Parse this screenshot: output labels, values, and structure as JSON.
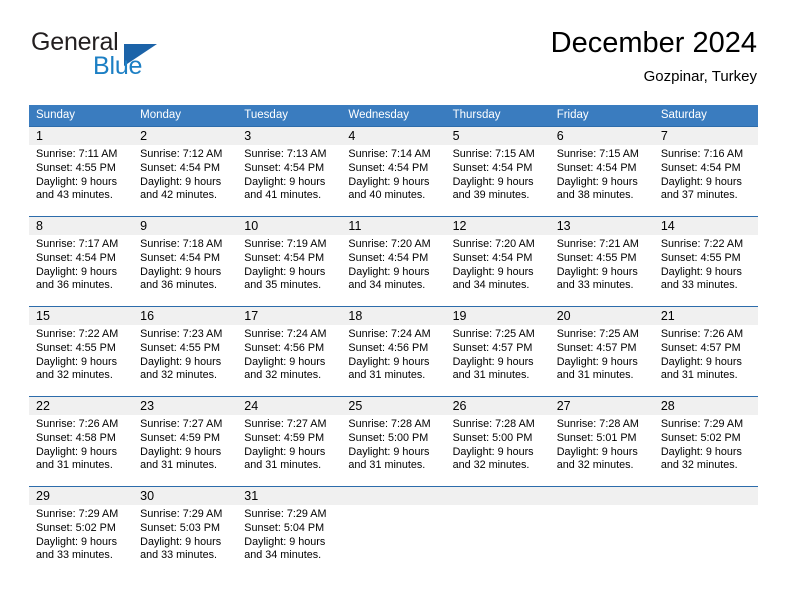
{
  "brand": {
    "name_top": "General",
    "name_bottom": "Blue",
    "colors": {
      "general": "#231f20",
      "blue": "#1c7fc4",
      "triangle": "#1c63a8"
    }
  },
  "header": {
    "title": "December 2024",
    "subtitle": "Gozpinar, Turkey"
  },
  "theme": {
    "header_bg": "#3a7cbf",
    "row_divider": "#2d6cab",
    "daynum_bg": "#f0f0f0"
  },
  "weekdays": [
    "Sunday",
    "Monday",
    "Tuesday",
    "Wednesday",
    "Thursday",
    "Friday",
    "Saturday"
  ],
  "weeks": [
    [
      {
        "day": "1",
        "sunrise": "Sunrise: 7:11 AM",
        "sunset": "Sunset: 4:55 PM",
        "daylight1": "Daylight: 9 hours",
        "daylight2": "and 43 minutes."
      },
      {
        "day": "2",
        "sunrise": "Sunrise: 7:12 AM",
        "sunset": "Sunset: 4:54 PM",
        "daylight1": "Daylight: 9 hours",
        "daylight2": "and 42 minutes."
      },
      {
        "day": "3",
        "sunrise": "Sunrise: 7:13 AM",
        "sunset": "Sunset: 4:54 PM",
        "daylight1": "Daylight: 9 hours",
        "daylight2": "and 41 minutes."
      },
      {
        "day": "4",
        "sunrise": "Sunrise: 7:14 AM",
        "sunset": "Sunset: 4:54 PM",
        "daylight1": "Daylight: 9 hours",
        "daylight2": "and 40 minutes."
      },
      {
        "day": "5",
        "sunrise": "Sunrise: 7:15 AM",
        "sunset": "Sunset: 4:54 PM",
        "daylight1": "Daylight: 9 hours",
        "daylight2": "and 39 minutes."
      },
      {
        "day": "6",
        "sunrise": "Sunrise: 7:15 AM",
        "sunset": "Sunset: 4:54 PM",
        "daylight1": "Daylight: 9 hours",
        "daylight2": "and 38 minutes."
      },
      {
        "day": "7",
        "sunrise": "Sunrise: 7:16 AM",
        "sunset": "Sunset: 4:54 PM",
        "daylight1": "Daylight: 9 hours",
        "daylight2": "and 37 minutes."
      }
    ],
    [
      {
        "day": "8",
        "sunrise": "Sunrise: 7:17 AM",
        "sunset": "Sunset: 4:54 PM",
        "daylight1": "Daylight: 9 hours",
        "daylight2": "and 36 minutes."
      },
      {
        "day": "9",
        "sunrise": "Sunrise: 7:18 AM",
        "sunset": "Sunset: 4:54 PM",
        "daylight1": "Daylight: 9 hours",
        "daylight2": "and 36 minutes."
      },
      {
        "day": "10",
        "sunrise": "Sunrise: 7:19 AM",
        "sunset": "Sunset: 4:54 PM",
        "daylight1": "Daylight: 9 hours",
        "daylight2": "and 35 minutes."
      },
      {
        "day": "11",
        "sunrise": "Sunrise: 7:20 AM",
        "sunset": "Sunset: 4:54 PM",
        "daylight1": "Daylight: 9 hours",
        "daylight2": "and 34 minutes."
      },
      {
        "day": "12",
        "sunrise": "Sunrise: 7:20 AM",
        "sunset": "Sunset: 4:54 PM",
        "daylight1": "Daylight: 9 hours",
        "daylight2": "and 34 minutes."
      },
      {
        "day": "13",
        "sunrise": "Sunrise: 7:21 AM",
        "sunset": "Sunset: 4:55 PM",
        "daylight1": "Daylight: 9 hours",
        "daylight2": "and 33 minutes."
      },
      {
        "day": "14",
        "sunrise": "Sunrise: 7:22 AM",
        "sunset": "Sunset: 4:55 PM",
        "daylight1": "Daylight: 9 hours",
        "daylight2": "and 33 minutes."
      }
    ],
    [
      {
        "day": "15",
        "sunrise": "Sunrise: 7:22 AM",
        "sunset": "Sunset: 4:55 PM",
        "daylight1": "Daylight: 9 hours",
        "daylight2": "and 32 minutes."
      },
      {
        "day": "16",
        "sunrise": "Sunrise: 7:23 AM",
        "sunset": "Sunset: 4:55 PM",
        "daylight1": "Daylight: 9 hours",
        "daylight2": "and 32 minutes."
      },
      {
        "day": "17",
        "sunrise": "Sunrise: 7:24 AM",
        "sunset": "Sunset: 4:56 PM",
        "daylight1": "Daylight: 9 hours",
        "daylight2": "and 32 minutes."
      },
      {
        "day": "18",
        "sunrise": "Sunrise: 7:24 AM",
        "sunset": "Sunset: 4:56 PM",
        "daylight1": "Daylight: 9 hours",
        "daylight2": "and 31 minutes."
      },
      {
        "day": "19",
        "sunrise": "Sunrise: 7:25 AM",
        "sunset": "Sunset: 4:57 PM",
        "daylight1": "Daylight: 9 hours",
        "daylight2": "and 31 minutes."
      },
      {
        "day": "20",
        "sunrise": "Sunrise: 7:25 AM",
        "sunset": "Sunset: 4:57 PM",
        "daylight1": "Daylight: 9 hours",
        "daylight2": "and 31 minutes."
      },
      {
        "day": "21",
        "sunrise": "Sunrise: 7:26 AM",
        "sunset": "Sunset: 4:57 PM",
        "daylight1": "Daylight: 9 hours",
        "daylight2": "and 31 minutes."
      }
    ],
    [
      {
        "day": "22",
        "sunrise": "Sunrise: 7:26 AM",
        "sunset": "Sunset: 4:58 PM",
        "daylight1": "Daylight: 9 hours",
        "daylight2": "and 31 minutes."
      },
      {
        "day": "23",
        "sunrise": "Sunrise: 7:27 AM",
        "sunset": "Sunset: 4:59 PM",
        "daylight1": "Daylight: 9 hours",
        "daylight2": "and 31 minutes."
      },
      {
        "day": "24",
        "sunrise": "Sunrise: 7:27 AM",
        "sunset": "Sunset: 4:59 PM",
        "daylight1": "Daylight: 9 hours",
        "daylight2": "and 31 minutes."
      },
      {
        "day": "25",
        "sunrise": "Sunrise: 7:28 AM",
        "sunset": "Sunset: 5:00 PM",
        "daylight1": "Daylight: 9 hours",
        "daylight2": "and 31 minutes."
      },
      {
        "day": "26",
        "sunrise": "Sunrise: 7:28 AM",
        "sunset": "Sunset: 5:00 PM",
        "daylight1": "Daylight: 9 hours",
        "daylight2": "and 32 minutes."
      },
      {
        "day": "27",
        "sunrise": "Sunrise: 7:28 AM",
        "sunset": "Sunset: 5:01 PM",
        "daylight1": "Daylight: 9 hours",
        "daylight2": "and 32 minutes."
      },
      {
        "day": "28",
        "sunrise": "Sunrise: 7:29 AM",
        "sunset": "Sunset: 5:02 PM",
        "daylight1": "Daylight: 9 hours",
        "daylight2": "and 32 minutes."
      }
    ],
    [
      {
        "day": "29",
        "sunrise": "Sunrise: 7:29 AM",
        "sunset": "Sunset: 5:02 PM",
        "daylight1": "Daylight: 9 hours",
        "daylight2": "and 33 minutes."
      },
      {
        "day": "30",
        "sunrise": "Sunrise: 7:29 AM",
        "sunset": "Sunset: 5:03 PM",
        "daylight1": "Daylight: 9 hours",
        "daylight2": "and 33 minutes."
      },
      {
        "day": "31",
        "sunrise": "Sunrise: 7:29 AM",
        "sunset": "Sunset: 5:04 PM",
        "daylight1": "Daylight: 9 hours",
        "daylight2": "and 34 minutes."
      },
      {
        "day": "",
        "sunrise": "",
        "sunset": "",
        "daylight1": "",
        "daylight2": ""
      },
      {
        "day": "",
        "sunrise": "",
        "sunset": "",
        "daylight1": "",
        "daylight2": ""
      },
      {
        "day": "",
        "sunrise": "",
        "sunset": "",
        "daylight1": "",
        "daylight2": ""
      },
      {
        "day": "",
        "sunrise": "",
        "sunset": "",
        "daylight1": "",
        "daylight2": ""
      }
    ]
  ]
}
